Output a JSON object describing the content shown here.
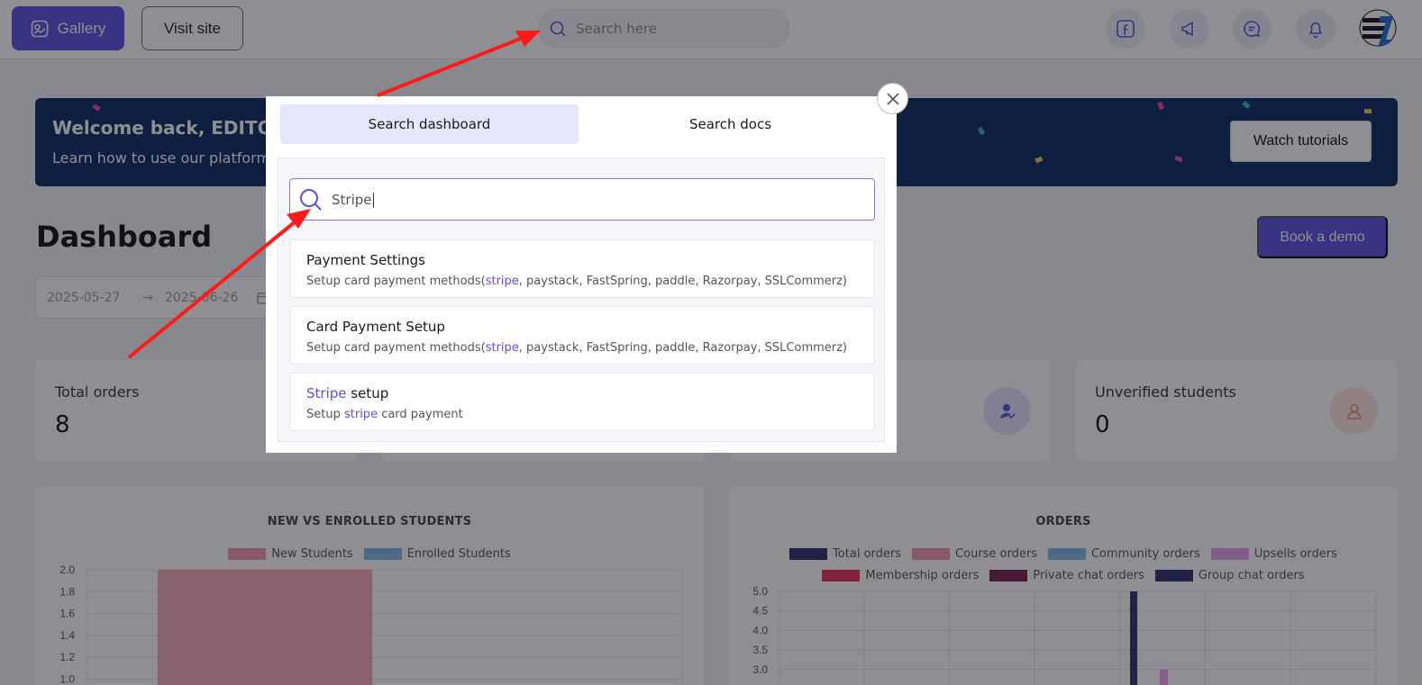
{
  "topbar": {
    "gallery_label": "Gallery",
    "visit_site_label": "Visit site",
    "search_placeholder": "Search here",
    "icons": [
      "facebook-icon",
      "megaphone-icon",
      "chat-icon",
      "bell-icon"
    ]
  },
  "banner": {
    "title": "Welcome back, EDITORI",
    "subtitle": "Learn how to use our platform",
    "watch_label": "Watch tutorials"
  },
  "page": {
    "title": "Dashboard",
    "book_demo_label": "Book a demo",
    "date_from": "2025-05-27",
    "date_to": "2025-06-26"
  },
  "stats": [
    {
      "label": "Total orders",
      "value": "8"
    },
    {
      "label": "Unverified students",
      "value": "0"
    }
  ],
  "charts": {
    "students": {
      "title": "NEW VS ENROLLED STUDENTS",
      "legend": [
        {
          "name": "New Students",
          "color": "#f29aab"
        },
        {
          "name": "Enrolled Students",
          "color": "#80b8e4"
        }
      ],
      "y_ticks": [
        "2.0",
        "1.8",
        "1.6",
        "1.4",
        "1.2",
        "1.0"
      ]
    },
    "orders": {
      "title": "ORDERS",
      "legend_row1": [
        {
          "name": "Total orders",
          "color": "#2d2f6c"
        },
        {
          "name": "Course orders",
          "color": "#f29aab"
        },
        {
          "name": "Community orders",
          "color": "#80b8e4"
        },
        {
          "name": "Upsells orders",
          "color": "#e9a1f0"
        }
      ],
      "legend_row2": [
        {
          "name": "Membership orders",
          "color": "#e0305a"
        },
        {
          "name": "Private chat orders",
          "color": "#7a1f52"
        },
        {
          "name": "Group chat orders",
          "color": "#2d2f6c"
        }
      ],
      "y_ticks": [
        "5.0",
        "4.5",
        "4.0",
        "3.5",
        "3.0"
      ]
    }
  },
  "chart_data": [
    {
      "type": "bar",
      "title": "NEW VS ENROLLED STUDENTS",
      "series": [
        {
          "name": "New Students",
          "values": [
            2
          ]
        },
        {
          "name": "Enrolled Students",
          "values": [
            0
          ]
        }
      ],
      "ylim": [
        1.0,
        2.0
      ]
    },
    {
      "type": "bar",
      "title": "ORDERS",
      "series": [
        {
          "name": "Total orders",
          "values": [
            5
          ]
        },
        {
          "name": "Upsells orders",
          "values": [
            3
          ]
        }
      ],
      "ylim": [
        3.0,
        5.0
      ]
    }
  ],
  "modal": {
    "tabs": [
      {
        "label": "Search dashboard",
        "active": true
      },
      {
        "label": "Search docs",
        "active": false
      }
    ],
    "query": "Stripe",
    "results": [
      {
        "title_pre": "Payment Settings",
        "title_hl": "",
        "title_post": "",
        "desc_pre": "Setup card payment methods(",
        "desc_hl": "stripe",
        "desc_post": ", paystack, FastSpring, paddle, Razorpay, SSLCommerz)"
      },
      {
        "title_pre": "Card Payment Setup",
        "title_hl": "",
        "title_post": "",
        "desc_pre": "Setup card payment methods(",
        "desc_hl": "stripe",
        "desc_post": ", paystack, FastSpring, paddle, Razorpay, SSLCommerz)"
      },
      {
        "title_pre": "",
        "title_hl": "Stripe",
        "title_post": " setup",
        "desc_pre": "Setup ",
        "desc_hl": "stripe",
        "desc_post": " card payment"
      }
    ]
  },
  "colors": {
    "accent": "#5b50e0",
    "banner_bg": "#0b2a5e",
    "annotation_arrow": "#ff1a1a"
  }
}
